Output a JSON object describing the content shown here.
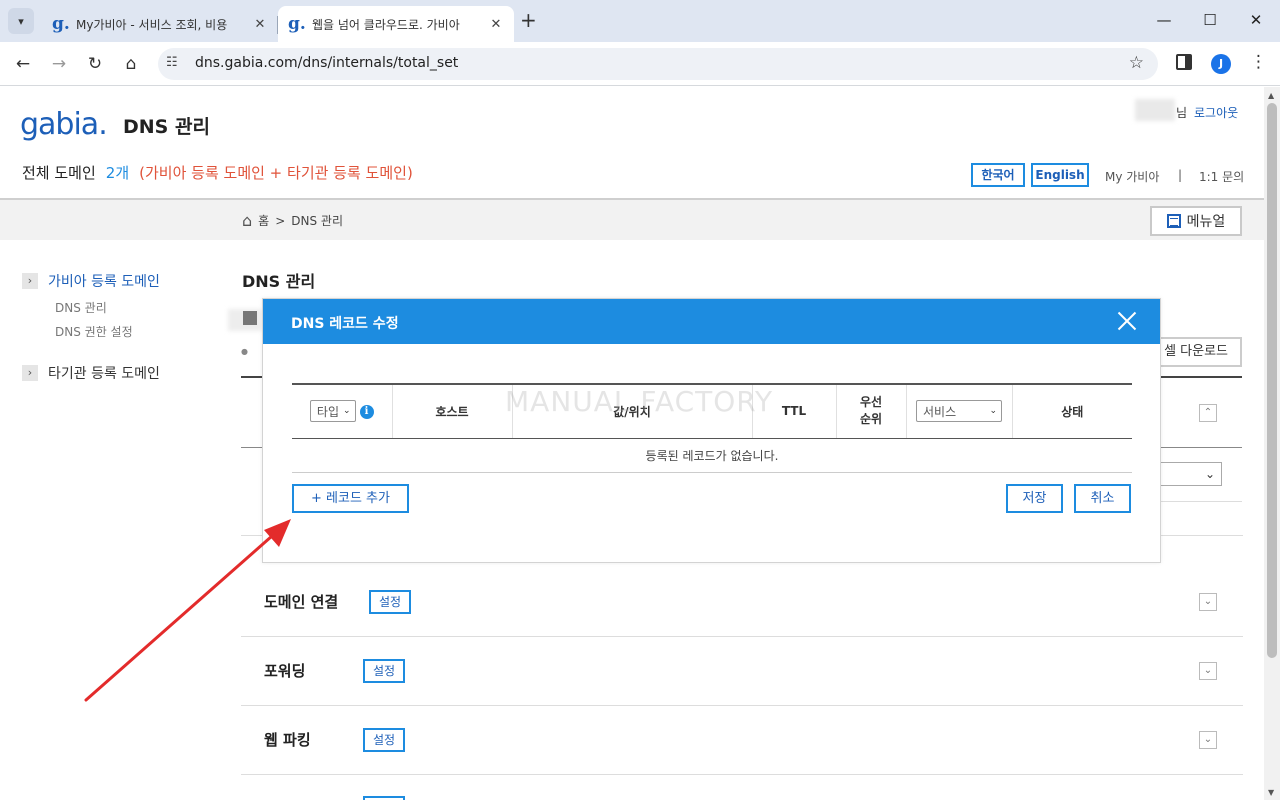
{
  "browser": {
    "tabs": [
      {
        "title": "My가비아 - 서비스 조회, 비용",
        "favicon": "g."
      },
      {
        "title": "웹을 넘어 클라우드로. 가비아",
        "favicon": "g."
      }
    ],
    "tab_list_icon": "▾",
    "tab_close_glyph": "✕",
    "new_tab_glyph": "+",
    "url": "dns.gabia.com/dns/internals/total_set",
    "profile_initial": "J",
    "window_controls": {
      "minimize": "—",
      "maximize": "☐",
      "close": "✕"
    }
  },
  "header": {
    "logo": "gabia.",
    "title": "DNS 관리",
    "user_suffix": "님",
    "logout": "로그아웃",
    "domain_count_label": "전체 도메인",
    "domain_count": "2개",
    "domain_count_note": "(가비아 등록 도메인 + 타기관 등록 도메인)",
    "lang_korean": "한국어",
    "lang_english": "English",
    "my_gabia": "My 가비아",
    "separator": "|",
    "inquiry": "1:1 문의"
  },
  "subnav": {
    "breadcrumb_home": "홈",
    "breadcrumb_sep": ">",
    "breadcrumb_current": "DNS 관리",
    "manual_button": "메뉴얼"
  },
  "sidebar": {
    "items": [
      {
        "label": "가비아 등록 도메인",
        "active": true,
        "children": [
          "DNS 관리",
          "DNS 권한 설정"
        ]
      },
      {
        "label": "타기관 등록 도메인",
        "active": false,
        "children": []
      }
    ]
  },
  "content": {
    "title": "DNS 관리",
    "excel_button": "셀 다운로드",
    "sections": [
      {
        "label": "도메인 연결",
        "button": "설정"
      },
      {
        "label": "포워딩",
        "button": "설정"
      },
      {
        "label": "웹 파킹",
        "button": "설정"
      }
    ]
  },
  "modal": {
    "title": "DNS 레코드 수정",
    "watermark": "MANUAL FACTORY",
    "columns": {
      "type_select": "타입",
      "host": "호스트",
      "value": "값/위치",
      "ttl": "TTL",
      "priority_line1": "우선",
      "priority_line2": "순위",
      "service_select": "서비스",
      "status": "상태"
    },
    "empty_message": "등록된 레코드가 없습니다.",
    "add_record": "+ 레코드 추가",
    "save": "저장",
    "cancel": "취소"
  },
  "colors": {
    "brand_blue": "#1d5fb8",
    "accent_blue": "#1d8ce0",
    "note_orange": "#e0533a",
    "annotation_red": "#e32b2b"
  }
}
